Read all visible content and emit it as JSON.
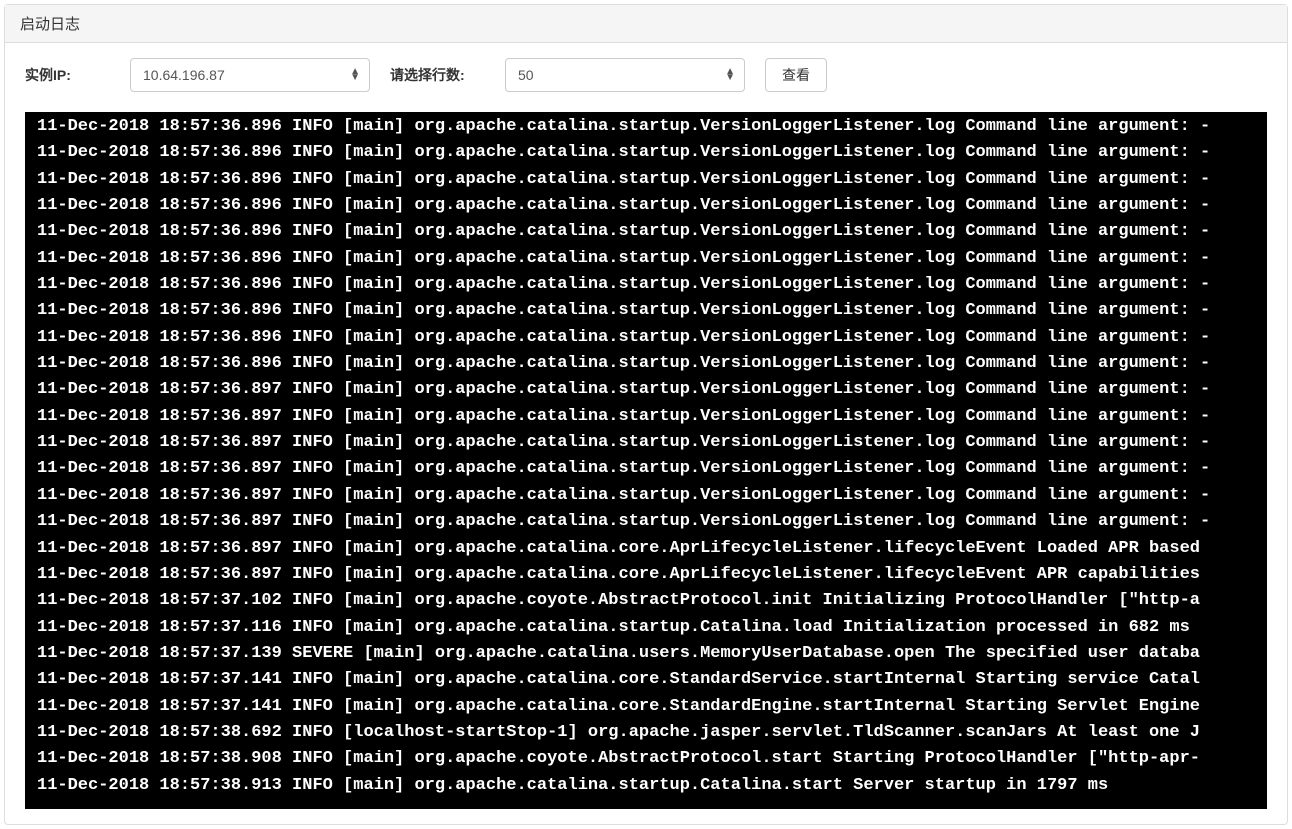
{
  "panel": {
    "title": "启动日志"
  },
  "form": {
    "instance_ip_label": "实例IP:",
    "instance_ip_value": "10.64.196.87",
    "lines_label": "请选择行数:",
    "lines_value": "50",
    "view_button": "查看"
  },
  "logs": [
    "11-Dec-2018 18:57:36.896 INFO [main] org.apache.catalina.startup.VersionLoggerListener.log Command line argument: -",
    "11-Dec-2018 18:57:36.896 INFO [main] org.apache.catalina.startup.VersionLoggerListener.log Command line argument: -",
    "11-Dec-2018 18:57:36.896 INFO [main] org.apache.catalina.startup.VersionLoggerListener.log Command line argument: -",
    "11-Dec-2018 18:57:36.896 INFO [main] org.apache.catalina.startup.VersionLoggerListener.log Command line argument: -",
    "11-Dec-2018 18:57:36.896 INFO [main] org.apache.catalina.startup.VersionLoggerListener.log Command line argument: -",
    "11-Dec-2018 18:57:36.896 INFO [main] org.apache.catalina.startup.VersionLoggerListener.log Command line argument: -",
    "11-Dec-2018 18:57:36.896 INFO [main] org.apache.catalina.startup.VersionLoggerListener.log Command line argument: -",
    "11-Dec-2018 18:57:36.896 INFO [main] org.apache.catalina.startup.VersionLoggerListener.log Command line argument: -",
    "11-Dec-2018 18:57:36.896 INFO [main] org.apache.catalina.startup.VersionLoggerListener.log Command line argument: -",
    "11-Dec-2018 18:57:36.896 INFO [main] org.apache.catalina.startup.VersionLoggerListener.log Command line argument: -",
    "11-Dec-2018 18:57:36.897 INFO [main] org.apache.catalina.startup.VersionLoggerListener.log Command line argument: -",
    "11-Dec-2018 18:57:36.897 INFO [main] org.apache.catalina.startup.VersionLoggerListener.log Command line argument: -",
    "11-Dec-2018 18:57:36.897 INFO [main] org.apache.catalina.startup.VersionLoggerListener.log Command line argument: -",
    "11-Dec-2018 18:57:36.897 INFO [main] org.apache.catalina.startup.VersionLoggerListener.log Command line argument: -",
    "11-Dec-2018 18:57:36.897 INFO [main] org.apache.catalina.startup.VersionLoggerListener.log Command line argument: -",
    "11-Dec-2018 18:57:36.897 INFO [main] org.apache.catalina.startup.VersionLoggerListener.log Command line argument: -",
    "11-Dec-2018 18:57:36.897 INFO [main] org.apache.catalina.core.AprLifecycleListener.lifecycleEvent Loaded APR based ",
    "11-Dec-2018 18:57:36.897 INFO [main] org.apache.catalina.core.AprLifecycleListener.lifecycleEvent APR capabilities ",
    "11-Dec-2018 18:57:37.102 INFO [main] org.apache.coyote.AbstractProtocol.init Initializing ProtocolHandler [\"http-a",
    "11-Dec-2018 18:57:37.116 INFO [main] org.apache.catalina.startup.Catalina.load Initialization processed in 682 ms",
    "11-Dec-2018 18:57:37.139 SEVERE [main] org.apache.catalina.users.MemoryUserDatabase.open The specified user databa",
    "11-Dec-2018 18:57:37.141 INFO [main] org.apache.catalina.core.StandardService.startInternal Starting service Catal",
    "11-Dec-2018 18:57:37.141 INFO [main] org.apache.catalina.core.StandardEngine.startInternal Starting Servlet Engine",
    "11-Dec-2018 18:57:38.692 INFO [localhost-startStop-1] org.apache.jasper.servlet.TldScanner.scanJars At least one J",
    "11-Dec-2018 18:57:38.908 INFO [main] org.apache.coyote.AbstractProtocol.start Starting ProtocolHandler [\"http-apr-",
    "11-Dec-2018 18:57:38.913 INFO [main] org.apache.catalina.startup.Catalina.start Server startup in 1797 ms"
  ]
}
